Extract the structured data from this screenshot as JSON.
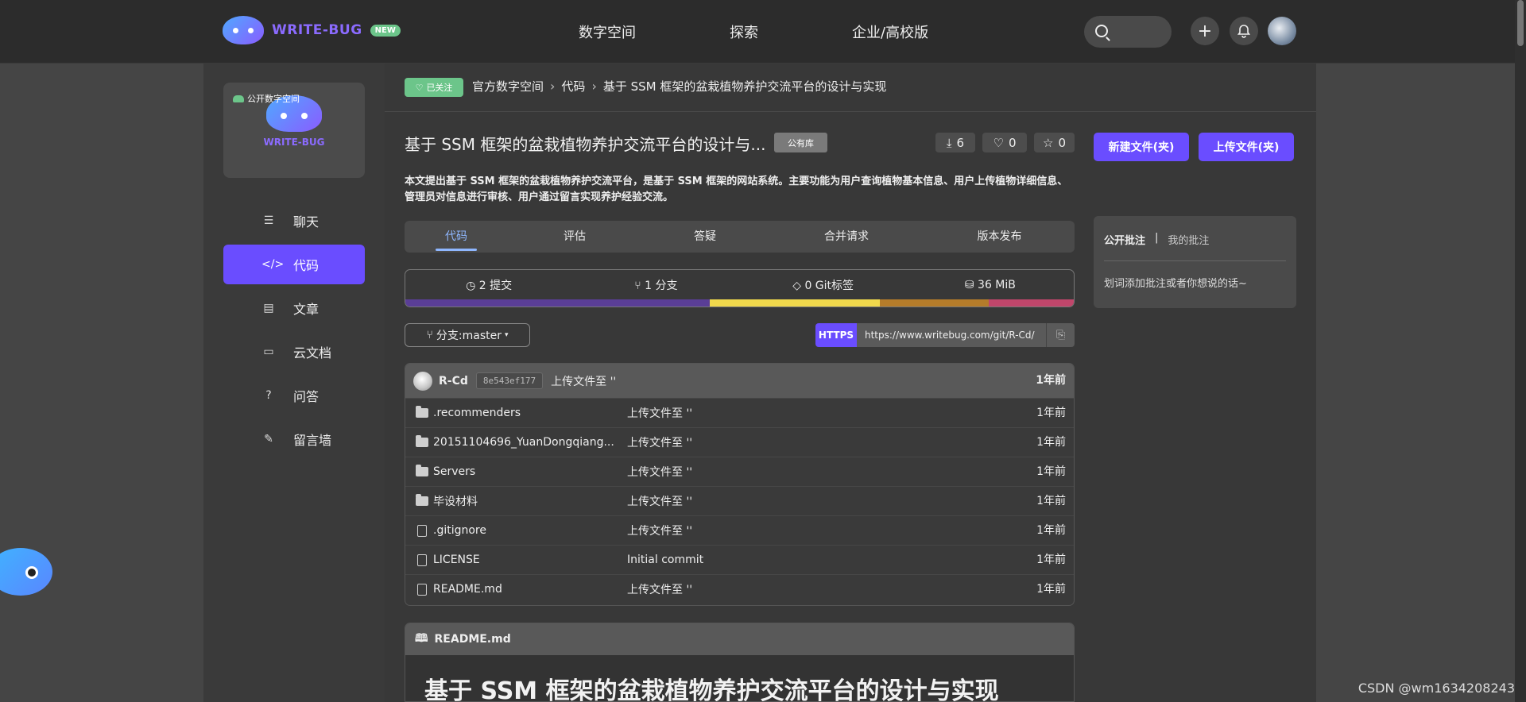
{
  "header": {
    "logo_text": "WRITE-BUG",
    "logo_badge": "NEW",
    "nav": [
      "数字空间",
      "探索",
      "企业/高校版"
    ],
    "add_icon": "plus-icon",
    "bell_icon": "bell-icon"
  },
  "space_card": {
    "tag": "公开数字空间",
    "name": "WRITE-BUG"
  },
  "sidebar": {
    "items": [
      {
        "label": "聊天",
        "icon": "chat-icon"
      },
      {
        "label": "代码",
        "icon": "code-icon",
        "active": true
      },
      {
        "label": "文章",
        "icon": "article-icon"
      },
      {
        "label": "云文档",
        "icon": "folder-icon"
      },
      {
        "label": "问答",
        "icon": "question-icon"
      },
      {
        "label": "留言墙",
        "icon": "edit-icon"
      }
    ]
  },
  "breadcrumb": {
    "followed_label": "已关注",
    "items": [
      "官方数字空间",
      "代码",
      "基于 SSM 框架的盆栽植物养护交流平台的设计与实现"
    ]
  },
  "repo": {
    "title": "基于 SSM 框架的盆栽植物养护交流平台的设计与...",
    "visibility": "公有库",
    "downloads": "6",
    "likes": "0",
    "stars": "0",
    "new_button": "新建文件(夹)",
    "upload_button": "上传文件(夹)",
    "description": "本文提出基于 SSM 框架的盆栽植物养护交流平台，是基于 SSM 框架的网站系统。主要功能为用户查询植物基本信息、用户上传植物详细信息、管理员对信息进行审核、用户通过留言实现养护经验交流。"
  },
  "tabs": [
    "代码",
    "评估",
    "答疑",
    "合并请求",
    "版本发布"
  ],
  "stats": {
    "commits": "2 提交",
    "branches": "1 分支",
    "tags": "0 Git标签",
    "size": "36 MiB"
  },
  "language_bar": [
    {
      "color": "#5a3e96",
      "percent": 45.5
    },
    {
      "color": "#f0d84c",
      "percent": 25.5
    },
    {
      "color": "#b57c2a",
      "percent": 16.3
    },
    {
      "color": "#c0466b",
      "percent": 12.7
    }
  ],
  "branch": {
    "label": "分支:master"
  },
  "clone": {
    "protocol": "HTTPS",
    "url": "https://www.writebug.com/git/R-Cd/"
  },
  "commit": {
    "author": "R-Cd",
    "hash": "8e543ef177",
    "message": "上传文件至 ''",
    "time": "1年前"
  },
  "files": [
    {
      "name": ".recommenders",
      "type": "folder",
      "message": "上传文件至 ''",
      "time": "1年前"
    },
    {
      "name": "20151104696_YuanDongqiang...",
      "type": "folder",
      "message": "上传文件至 ''",
      "time": "1年前"
    },
    {
      "name": "Servers",
      "type": "folder",
      "message": "上传文件至 ''",
      "time": "1年前"
    },
    {
      "name": "毕设材料",
      "type": "folder",
      "message": "上传文件至 ''",
      "time": "1年前"
    },
    {
      "name": ".gitignore",
      "type": "file",
      "message": "上传文件至 ''",
      "time": "1年前"
    },
    {
      "name": "LICENSE",
      "type": "file",
      "message": "Initial commit",
      "time": "1年前"
    },
    {
      "name": "README.md",
      "type": "file",
      "message": "上传文件至 ''",
      "time": "1年前"
    }
  ],
  "readme": {
    "filename": "README.md",
    "heading": "基于 SSM 框架的盆栽植物养护交流平台的设计与实现"
  },
  "annotations": {
    "public_tab": "公开批注",
    "divider": "|",
    "mine_tab": "我的批注",
    "hint": "划词添加批注或者你想说的话~"
  },
  "watermark": "CSDN @wm1634208243"
}
